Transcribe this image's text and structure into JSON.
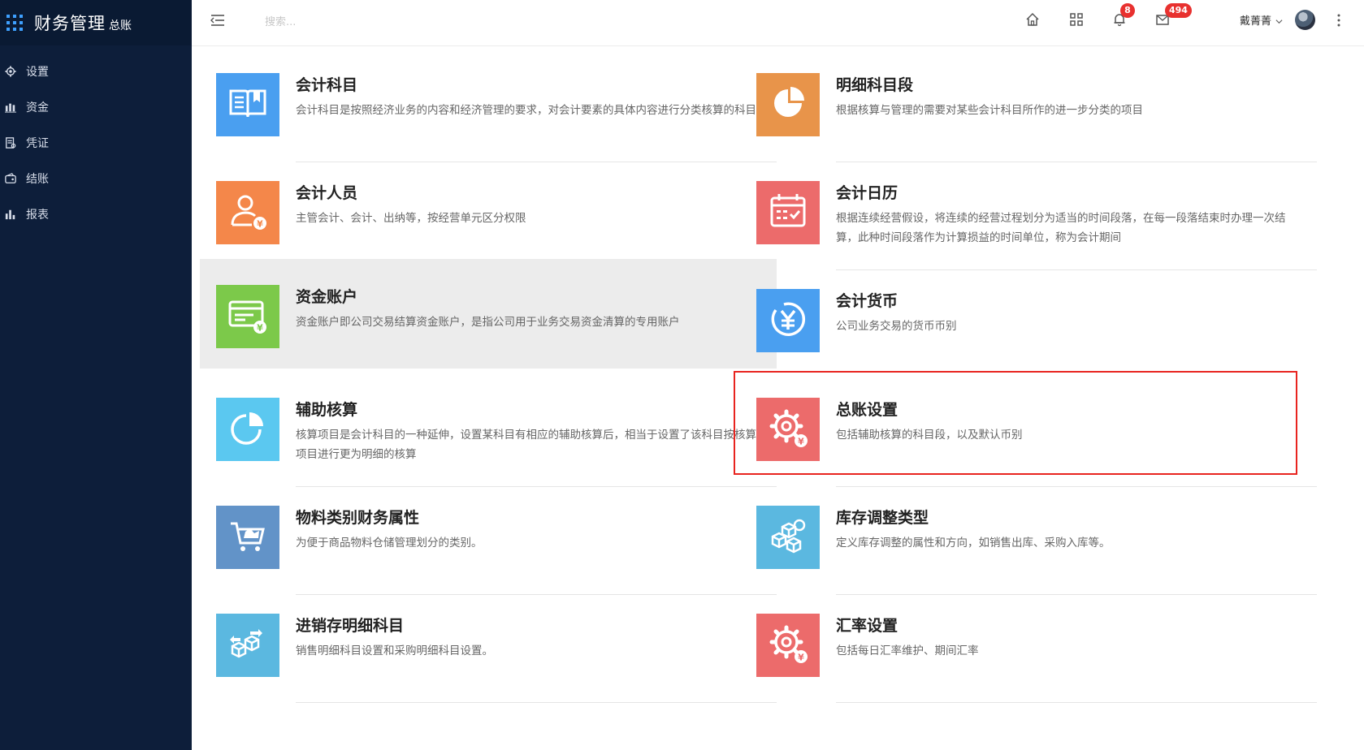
{
  "app": {
    "title": "财务管理",
    "subtitle": "总账"
  },
  "sidebar": {
    "items": [
      {
        "label": "设置",
        "icon": "gear-icon"
      },
      {
        "label": "资金",
        "icon": "fund-icon"
      },
      {
        "label": "凭证",
        "icon": "voucher-icon"
      },
      {
        "label": "结账",
        "icon": "wallet-icon"
      },
      {
        "label": "报表",
        "icon": "bar-chart-icon"
      }
    ]
  },
  "header": {
    "search_placeholder": "搜索...",
    "notification_count": "8",
    "message_count": "494",
    "user_name": "戴菁菁"
  },
  "cards": [
    {
      "name": "会计科目",
      "desc": "会计科目是按照经济业务的内容和经济管理的要求，对会计要素的具体内容进行分类核算的科目",
      "color": "#4a9ff0",
      "icon": "book-icon"
    },
    {
      "name": "明细科目段",
      "desc": "根据核算与管理的需要对某些会计科目所作的进一步分类的项目",
      "color": "#e8944a",
      "icon": "pie-chart-icon"
    },
    {
      "name": "会计人员",
      "desc": "主管会计、会计、出纳等，按经营单元区分权限",
      "color": "#f4874a",
      "icon": "user-yuan-icon"
    },
    {
      "name": "会计日历",
      "desc": "根据连续经营假设，将连续的经营过程划分为适当的时间段落，在每一段落结束时办理一次结算，此种时间段落作为计算损益的时间单位，称为会计期间",
      "color": "#ec6b6b",
      "icon": "calendar-icon"
    },
    {
      "name": "资金账户",
      "desc": "资金账户即公司交易结算资金账户，是指公司用于业务交易资金清算的专用账户",
      "color": "#7cc94a",
      "icon": "card-yuan-icon"
    },
    {
      "name": "会计货币",
      "desc": "公司业务交易的货币币别",
      "color": "#4a9ff0",
      "icon": "yuan-circle-icon"
    },
    {
      "name": "辅助核算",
      "desc": "核算项目是会计科目的一种延伸，设置某科目有相应的辅助核算后，相当于设置了该科目按核算项目进行更为明细的核算",
      "color": "#5bc8f0",
      "icon": "pie-chart-icon"
    },
    {
      "name": "总账设置",
      "desc": "包括辅助核算的科目段，以及默认币别",
      "color": "#ec6b6b",
      "icon": "gear-yuan-icon"
    },
    {
      "name": "物料类别财务属性",
      "desc": "为便于商品物料仓储管理划分的类别。",
      "color": "#6293c8",
      "icon": "cart-icon"
    },
    {
      "name": "库存调整类型",
      "desc": "定义库存调整的属性和方向，如销售出库、采购入库等。",
      "color": "#5bb8e0",
      "icon": "boxes-icon"
    },
    {
      "name": "进销存明细科目",
      "desc": "销售明细科目设置和采购明细科目设置。",
      "color": "#5bb8e0",
      "icon": "boxes-arrows-icon"
    },
    {
      "name": "汇率设置",
      "desc": "包括每日汇率维护、期间汇率",
      "color": "#ec6b6b",
      "icon": "gear-yuan-icon"
    }
  ]
}
